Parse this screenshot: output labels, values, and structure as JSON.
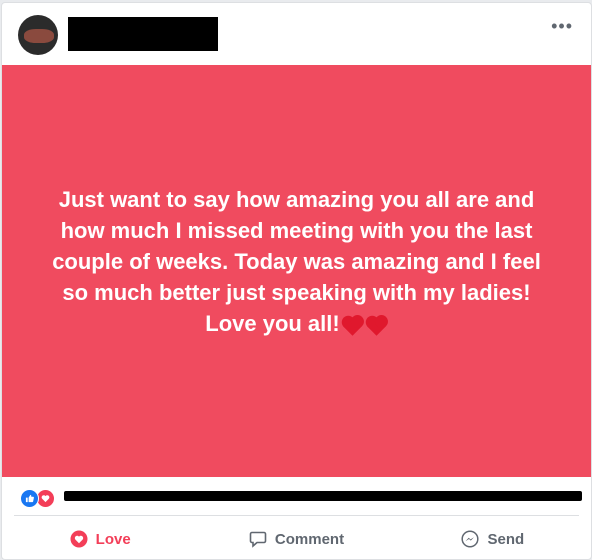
{
  "post": {
    "text_lines": [
      "Just want to say how amazing you all are and",
      "how much I missed meeting with you the last",
      "couple of weeks. Today was amazing and I feel",
      "so much better just speaking with my ladies!",
      "Love you all!"
    ],
    "background_color": "#f04b5f"
  },
  "header": {
    "more_icon": "more-horizontal-icon"
  },
  "reactions": {
    "icons": [
      "like-reaction-icon",
      "love-reaction-icon"
    ]
  },
  "actions": {
    "love_label": "Love",
    "comment_label": "Comment",
    "send_label": "Send"
  },
  "colors": {
    "like": "#1877f2",
    "love": "#f33e58"
  }
}
